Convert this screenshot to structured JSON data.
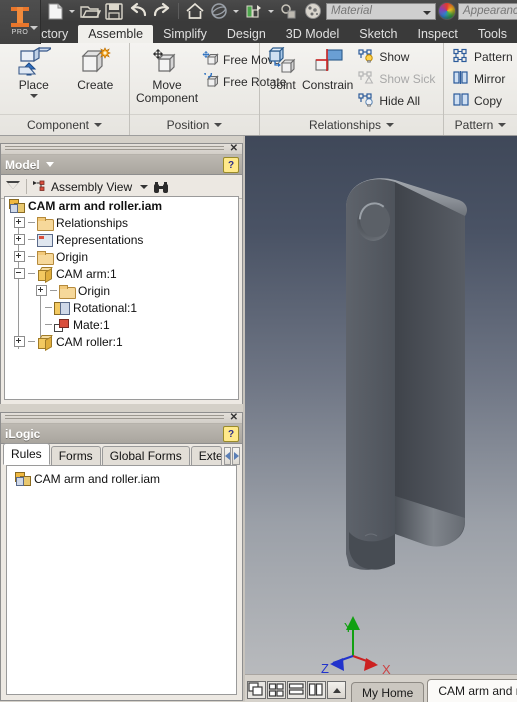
{
  "app": {
    "logo_text": "PRO",
    "logo_name": "autodesk-inventor-logo"
  },
  "quick_access": {
    "items": [
      {
        "name": "new-document",
        "icon": "new-file-icon"
      },
      {
        "name": "new-document-dropdown",
        "icon": "chevron-down-icon"
      },
      {
        "name": "open-document",
        "icon": "open-folder-icon"
      },
      {
        "name": "save-document",
        "icon": "floppy-save-icon"
      },
      {
        "name": "undo",
        "icon": "undo-arrow-icon"
      },
      {
        "name": "redo",
        "icon": "redo-arrow-icon"
      },
      {
        "name": "home-view",
        "icon": "home-icon"
      },
      {
        "name": "orbit",
        "icon": "orbit-icon"
      },
      {
        "name": "orbit-dropdown",
        "icon": "chevron-down-icon"
      },
      {
        "name": "update",
        "icon": "update-icon"
      },
      {
        "name": "update-dropdown",
        "icon": "chevron-down-icon"
      },
      {
        "name": "select-mode",
        "icon": "select-icon"
      },
      {
        "name": "material-browser",
        "icon": "material-sphere-icon"
      }
    ],
    "material": {
      "placeholder": "Material",
      "value": ""
    },
    "appearance": {
      "placeholder": "Appearance",
      "value": ""
    }
  },
  "ribbon": {
    "tabs": [
      {
        "label": "Factory",
        "active": false
      },
      {
        "label": "Assemble",
        "active": true
      },
      {
        "label": "Simplify",
        "active": false
      },
      {
        "label": "Design",
        "active": false
      },
      {
        "label": "3D Model",
        "active": false
      },
      {
        "label": "Sketch",
        "active": false
      },
      {
        "label": "Inspect",
        "active": false
      },
      {
        "label": "Tools",
        "active": false
      }
    ],
    "panels": [
      {
        "label": "Component",
        "big_buttons": [
          {
            "label": "Place",
            "icon": "place-component-icon",
            "has_dropdown": true
          },
          {
            "label": "Create",
            "icon": "create-component-icon",
            "has_dropdown": false
          }
        ],
        "small_buttons": []
      },
      {
        "label": "Position",
        "big_buttons": [
          {
            "label": "Move\nComponent",
            "line1": "Move",
            "line2": "Component",
            "icon": "move-component-icon",
            "has_dropdown": false
          }
        ],
        "small_buttons": [
          {
            "label": "Free Move",
            "icon": "free-move-icon",
            "disabled": false
          },
          {
            "label": "Free Rotate",
            "icon": "free-rotate-icon",
            "disabled": false
          }
        ]
      },
      {
        "label": "Relationships",
        "big_buttons": [
          {
            "label": "Joint",
            "icon": "joint-icon",
            "has_dropdown": false
          },
          {
            "label": "Constrain",
            "icon": "constrain-icon",
            "has_dropdown": false
          }
        ],
        "small_buttons": [
          {
            "label": "Show",
            "icon": "show-relationship-icon",
            "disabled": false
          },
          {
            "label": "Show Sick",
            "icon": "show-sick-icon",
            "disabled": true
          },
          {
            "label": "Hide All",
            "icon": "hide-all-icon",
            "disabled": false
          }
        ]
      },
      {
        "label": "Pattern",
        "big_buttons": [],
        "small_buttons": [
          {
            "label": "Pattern",
            "icon": "pattern-icon",
            "disabled": false
          },
          {
            "label": "Mirror",
            "icon": "mirror-icon",
            "disabled": false
          },
          {
            "label": "Copy",
            "icon": "copy-icon",
            "disabled": false
          }
        ]
      }
    ]
  },
  "model_panel": {
    "title": "Model",
    "help_label": "?",
    "close_label": "✕",
    "toolbar": {
      "filter_icon": "filter-funnel-icon",
      "view_selector": "Assembly View",
      "find_icon": "binoculars-find-icon"
    },
    "tree": [
      {
        "label": "CAM arm and roller.iam",
        "depth": 0,
        "icon": "assembly-icon",
        "expander": "none",
        "root": true
      },
      {
        "label": "Relationships",
        "depth": 1,
        "icon": "folder-icon",
        "expander": "plus"
      },
      {
        "label": "Representations",
        "depth": 1,
        "icon": "representations-icon",
        "expander": "plus"
      },
      {
        "label": "Origin",
        "depth": 1,
        "icon": "folder-icon",
        "expander": "plus"
      },
      {
        "label": "CAM arm:1",
        "depth": 1,
        "icon": "part-icon",
        "expander": "minus"
      },
      {
        "label": "Origin",
        "depth": 2,
        "icon": "folder-icon",
        "expander": "plus"
      },
      {
        "label": "Rotational:1",
        "depth": 2,
        "icon": "rotational-joint-icon",
        "expander": "none"
      },
      {
        "label": "Mate:1",
        "depth": 2,
        "icon": "mate-constraint-icon",
        "expander": "none"
      },
      {
        "label": "CAM roller:1",
        "depth": 1,
        "icon": "part-icon",
        "expander": "plus"
      }
    ]
  },
  "ilogic_panel": {
    "title": "iLogic",
    "help_label": "?",
    "close_label": "✕",
    "tabs": [
      {
        "label": "Rules",
        "active": true
      },
      {
        "label": "Forms",
        "active": false
      },
      {
        "label": "Global Forms",
        "active": false
      },
      {
        "label": "Externa",
        "active": false
      }
    ],
    "scroll_left": "◀",
    "scroll_right": "▶",
    "items": [
      {
        "label": "CAM arm and roller.iam",
        "icon": "assembly-icon"
      }
    ]
  },
  "viewport": {
    "model_name": "cam-arm-part",
    "axis_indicator": {
      "x_label": "X",
      "y_label": "Y",
      "z_label": "Z",
      "x_color": "#cc2222",
      "y_color": "#11a011",
      "z_color": "#2233cc"
    },
    "background_top": "#3f4859",
    "background_bottom": "#b8babd",
    "model_color": "#5a5f66"
  },
  "status_bar": {
    "window_buttons": [
      {
        "name": "cascade-windows-button",
        "icon": "cascade-icon"
      },
      {
        "name": "tile-grid-button",
        "icon": "tile-grid-icon"
      },
      {
        "name": "tile-horizontal-button",
        "icon": "tile-horizontal-icon"
      },
      {
        "name": "tile-vertical-button",
        "icon": "tile-vertical-icon"
      },
      {
        "name": "expand-tabs-button",
        "icon": "chevron-up-icon"
      }
    ],
    "document_tabs": [
      {
        "label": "My Home",
        "active": false
      },
      {
        "label": "CAM arm and ro..",
        "active": true
      }
    ]
  }
}
